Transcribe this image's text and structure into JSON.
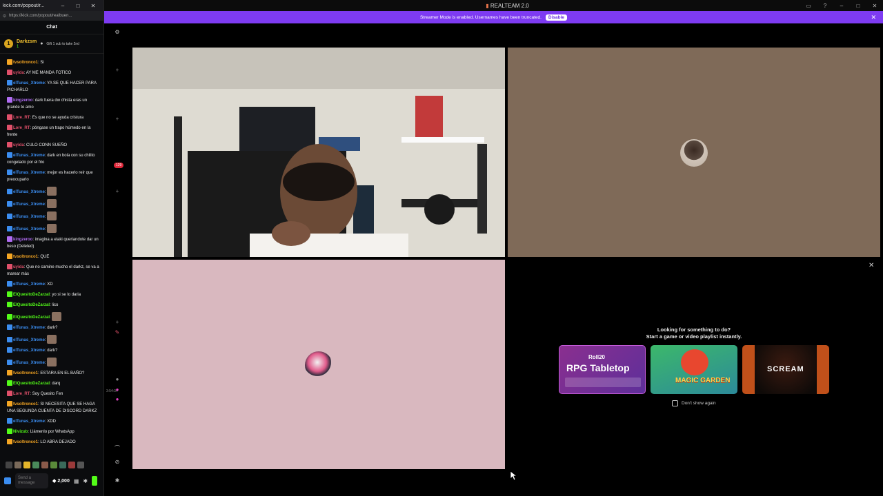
{
  "chat_window": {
    "title": "kick.com/popout/r...",
    "url": "https://kick.com/popout/realbuen...",
    "header": "Chat",
    "pinned": {
      "name": "Darkzsm",
      "count": "1",
      "gift_text": "Gift 1 sub to take 2nd"
    },
    "messages": [
      {
        "user": "tvsoltronco1",
        "text": "Si",
        "user_color": "#f5a623"
      },
      {
        "user": "uyida",
        "text": "AY ME MANDA FOTICO",
        "user_color": "#e0506a"
      },
      {
        "user": "elTunas_Xtreme",
        "text": "YA SE QUE HACER PARA PICHARLO",
        "user_color": "#3b8df0"
      },
      {
        "user": "kingzeroo",
        "text": "dark fuera dw chista eras un grande te amo",
        "user_color": "#b06cf2"
      },
      {
        "user": "Lore_RT",
        "text": "Es que no se ayuda cristura",
        "user_color": "#e0506a"
      },
      {
        "user": "Lore_RT",
        "text": "póngase un trapo húmedo en la frente",
        "user_color": "#e0506a"
      },
      {
        "user": "uyida",
        "text": "CULO CONN SUEÑO",
        "user_color": "#e0506a"
      },
      {
        "user": "elTunas_Xtreme",
        "text": "dark en bola con su chilito congelado por el frio",
        "user_color": "#3b8df0"
      },
      {
        "user": "elTunas_Xtreme",
        "text": "mejor es hacerlo reir que preocuparlo",
        "user_color": "#3b8df0"
      },
      {
        "user": "elTunas_Xtreme",
        "text": "",
        "user_color": "#3b8df0"
      },
      {
        "user": "elTunas_Xtreme",
        "text": "",
        "user_color": "#3b8df0"
      },
      {
        "user": "elTunas_Xtreme",
        "text": "",
        "user_color": "#3b8df0"
      },
      {
        "user": "elTunas_Xtreme",
        "text": "",
        "user_color": "#3b8df0"
      },
      {
        "user": "kingzeroo",
        "text": "imagina a elaki queriandote dar un beso (Deleted)",
        "user_color": "#b06cf2"
      },
      {
        "user": "tvsoltronco1",
        "text": "QUE",
        "user_color": "#f5a623"
      },
      {
        "user": "uyida",
        "text": "Que no camine mucho el darkz, se va a marear más",
        "user_color": "#e0506a"
      },
      {
        "user": "elTunas_Xtreme",
        "text": "XD",
        "user_color": "#3b8df0"
      },
      {
        "user": "ElQuesitoDeZarzal",
        "text": "yo si se lo daria",
        "user_color": "#53fc18"
      },
      {
        "user": "ElQuesitoDeZarzal",
        "text": "lico",
        "user_color": "#53fc18"
      },
      {
        "user": "ElQuesitoDeZarzal",
        "text": "",
        "user_color": "#53fc18"
      },
      {
        "user": "elTunas_Xtreme",
        "text": "dark?",
        "user_color": "#3b8df0"
      },
      {
        "user": "elTunas_Xtreme",
        "text": "",
        "user_color": "#3b8df0"
      },
      {
        "user": "elTunas_Xtreme",
        "text": "dark?",
        "user_color": "#3b8df0"
      },
      {
        "user": "elTunas_Xtreme",
        "text": "",
        "user_color": "#3b8df0"
      },
      {
        "user": "tvsoltronco1",
        "text": "ESTARA EN EL BAÑO?",
        "user_color": "#f5a623"
      },
      {
        "user": "ElQuesitoDeZarzal",
        "text": "darq",
        "user_color": "#53fc18"
      },
      {
        "user": "Lore_RT",
        "text": "Soy Quesito Fen",
        "user_color": "#e0506a"
      },
      {
        "user": "tvsoltronco1",
        "text": "SI NECESITA QUE SE HAGA UNA SEGUNDA CUENTA DE DISCORD DARKZ",
        "user_color": "#f5a623"
      },
      {
        "user": "elTunas_Xtreme",
        "text": "XDD",
        "user_color": "#3b8df0"
      },
      {
        "user": "Nivizub",
        "text": "Llámenlo por WhatsApp",
        "user_color": "#53fc18"
      },
      {
        "user": "tvsoltronco1",
        "text": "LO ABRA DEJADO",
        "user_color": "#f5a623"
      }
    ],
    "input_placeholder": "Send a message",
    "points": "2,000"
  },
  "app": {
    "title": "REALTEAM 2.0",
    "banner_text": "Streamer Mode is enabled. Usernames have been truncated.",
    "banner_button": "Disable",
    "unread_badge": "129",
    "timer": "3:54:34"
  },
  "activities": {
    "prompt_line1": "Looking for something to do?",
    "prompt_line2": "Start a game or video playlist instantly.",
    "games": [
      {
        "title": "RPG Tabletop",
        "brand": "Roll20"
      },
      {
        "title": "MAGIC GARDEN"
      },
      {
        "title": "SCREAM"
      }
    ],
    "dont_show": "Don't show again"
  }
}
